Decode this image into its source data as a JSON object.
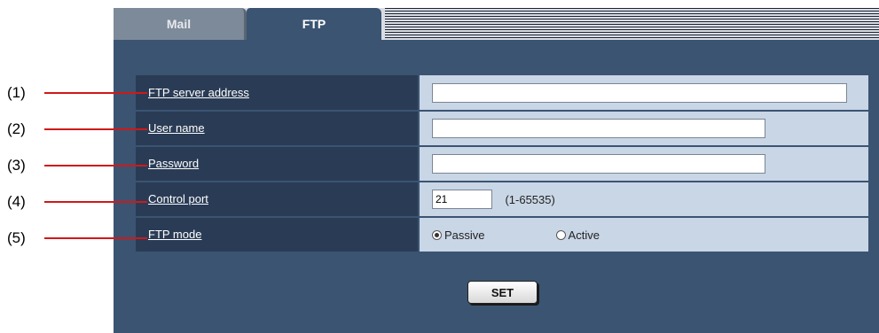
{
  "tabs": [
    {
      "label": "Mail",
      "active": false
    },
    {
      "label": "FTP",
      "active": true
    }
  ],
  "form": {
    "rows": [
      {
        "label": "FTP server address",
        "value": ""
      },
      {
        "label": "User name",
        "value": ""
      },
      {
        "label": "Password",
        "value": ""
      },
      {
        "label": "Control port",
        "value": "21",
        "range": "(1-65535)"
      },
      {
        "label": "FTP mode",
        "options": [
          "Passive",
          "Active"
        ],
        "selected": "Passive"
      }
    ]
  },
  "set_label": "SET",
  "callouts": [
    "(1)",
    "(2)",
    "(3)",
    "(4)",
    "(5)"
  ],
  "colors": {
    "panel": "#3b5472",
    "label_bg": "#2a3c55",
    "value_bg": "#c9d6e6",
    "callout_line": "#d01818"
  }
}
